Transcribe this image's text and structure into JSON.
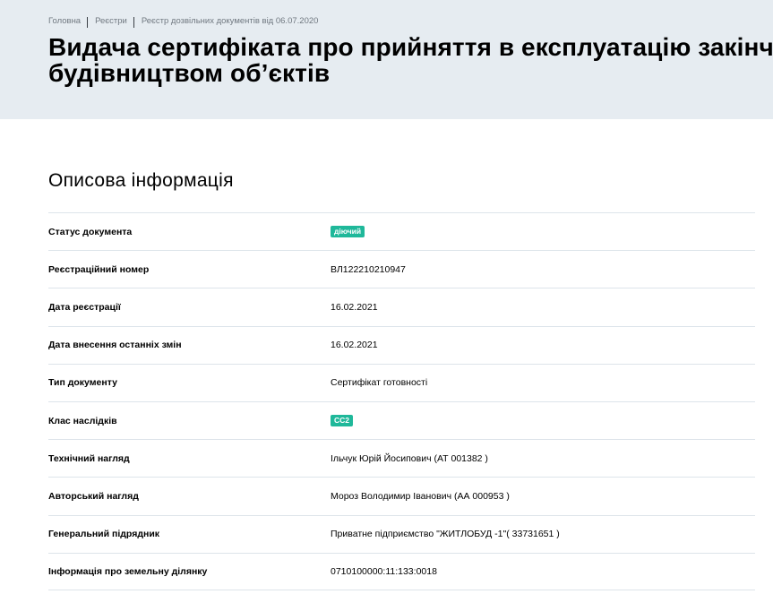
{
  "breadcrumb": {
    "items": [
      "Головна",
      "Реєстри",
      "Реєстр дозвільних документів від 06.07.2020"
    ]
  },
  "header": {
    "title_line1": "Видача сертифіката про прийняття в експлуатацію закінчених",
    "title_line2": "будівництвом об’єктів"
  },
  "section": {
    "title": "Описова інформація"
  },
  "fields": [
    {
      "label": "Статус документа",
      "value": "діючий",
      "type": "badge"
    },
    {
      "label": "Реєстраційний номер",
      "value": "ВЛ122210210947",
      "type": "text"
    },
    {
      "label": "Дата реєстрації",
      "value": "16.02.2021",
      "type": "text"
    },
    {
      "label": "Дата внесення останніх змін",
      "value": "16.02.2021",
      "type": "text"
    },
    {
      "label": "Тип документу",
      "value": "Сертифікат готовності",
      "type": "text"
    },
    {
      "label": "Клас наслідків",
      "value": "СС2",
      "type": "badge"
    },
    {
      "label": "Технічний нагляд",
      "value": "Ільчук Юрій Йосипович (АТ 001382 )",
      "type": "text"
    },
    {
      "label": "Авторський нагляд",
      "value": "Мороз Володимир Іванович (АА 000953 )",
      "type": "text"
    },
    {
      "label": "Генеральний підрядник",
      "value": "Приватне підприємство \"ЖИТЛОБУД -1\"( 33731651 )",
      "type": "text"
    },
    {
      "label": "Інформація про земельну ділянку",
      "value": "0710100000:11:133:0018",
      "type": "text"
    }
  ],
  "colors": {
    "header_bg": "#e6ecf1",
    "badge_bg": "#1fb89a",
    "divider": "#dde4ea"
  }
}
